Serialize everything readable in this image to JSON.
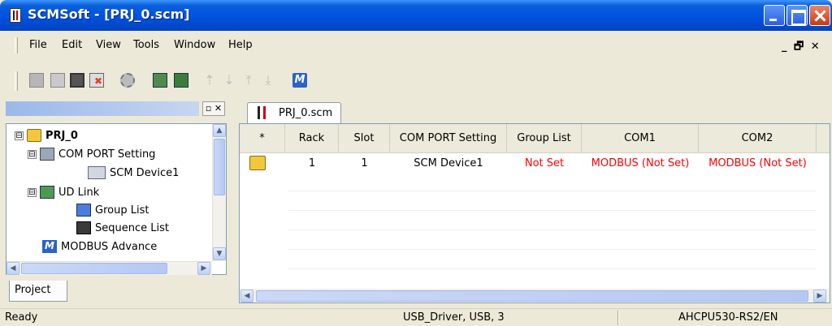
{
  "window": {
    "title": "SCMSoft - [PRJ_0.scm]"
  },
  "menu": {
    "items": [
      "File",
      "Edit",
      "View",
      "Tools",
      "Window",
      "Help"
    ]
  },
  "toolbar": {
    "icons": [
      "new-icon",
      "open-icon",
      "save-icon",
      "close-project-icon",
      "settings-gear-icon",
      "download-icon",
      "upload-icon",
      "move-up-icon",
      "move-down-icon",
      "move-top-icon",
      "move-bottom-icon",
      "modbus-icon"
    ]
  },
  "project_pane": {
    "tab_label": "Project",
    "tree": [
      {
        "label": "PRJ_0",
        "level": 0,
        "expander": "⊟",
        "icon": "project-icon",
        "bold": true
      },
      {
        "label": "COM PORT Setting",
        "level": 1,
        "expander": "⊟",
        "icon": "com-port-icon"
      },
      {
        "label": "SCM Device1",
        "level": 2,
        "icon": "device-icon"
      },
      {
        "label": "UD Link",
        "level": 1,
        "expander": "⊟",
        "icon": "ud-link-icon"
      },
      {
        "label": "Group List",
        "level": 2,
        "icon": "group-list-icon"
      },
      {
        "label": "Sequence List",
        "level": 2,
        "icon": "sequence-list-icon"
      },
      {
        "label": "MODBUS Advance",
        "level": 1,
        "icon": "modbus-icon"
      }
    ]
  },
  "document": {
    "tab_label": "PRJ_0.scm",
    "columns": [
      "*",
      "Rack",
      "Slot",
      "COM PORT Setting",
      "Group List",
      "COM1",
      "COM2"
    ],
    "rows": [
      {
        "rack": "1",
        "slot": "1",
        "com_port_setting": "SCM Device1",
        "group_list": "Not Set",
        "com1": "MODBUS (Not Set)",
        "com2": "MODBUS (Not Set)"
      }
    ],
    "alert_color": "#ff0000"
  },
  "status": {
    "left": "Ready",
    "middle": "USB_Driver, USB, 3",
    "right": "AHCPU530-RS2/EN"
  }
}
